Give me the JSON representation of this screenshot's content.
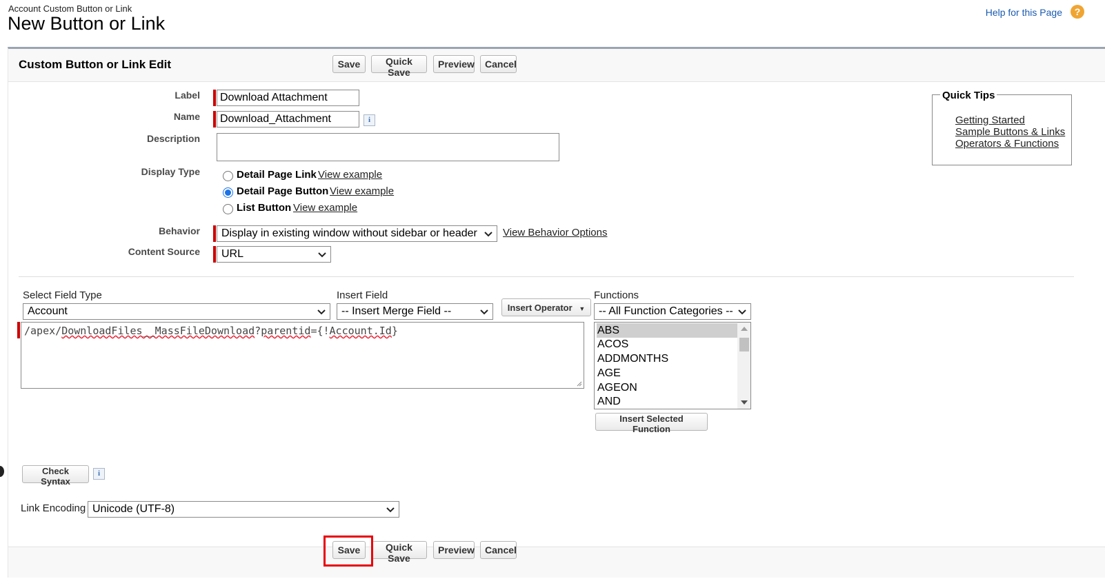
{
  "header": {
    "breadcrumb": "Account Custom Button or Link",
    "title": "New Button or Link",
    "help_link": "Help for this Page",
    "help_icon": "?"
  },
  "section_title": "Custom Button or Link Edit",
  "buttons": {
    "save": "Save",
    "quick_save": "Quick Save",
    "preview": "Preview",
    "cancel": "Cancel",
    "check_syntax": "Check Syntax",
    "insert_operator": "Insert Operator",
    "insert_selected_function": "Insert Selected Function"
  },
  "fields": {
    "label": {
      "label": "Label",
      "value": "Download Attachment"
    },
    "name": {
      "label": "Name",
      "value": "Download_Attachment"
    },
    "description": {
      "label": "Description",
      "value": ""
    },
    "display_type": {
      "label": "Display Type",
      "options": [
        {
          "label": "Detail Page Link",
          "link": "View example",
          "selected": false
        },
        {
          "label": "Detail Page Button",
          "link": "View example",
          "selected": true
        },
        {
          "label": "List Button",
          "link": "View example",
          "selected": false
        }
      ]
    },
    "behavior": {
      "label": "Behavior",
      "value": "Display in existing window without sidebar or header",
      "link": "View Behavior Options"
    },
    "content_source": {
      "label": "Content Source",
      "value": "URL"
    }
  },
  "quick_tips": {
    "title": "Quick Tips",
    "links": [
      "Getting Started",
      "Sample Buttons & Links",
      "Operators & Functions"
    ]
  },
  "formula_builder": {
    "select_field_type": {
      "label": "Select Field Type",
      "value": "Account"
    },
    "insert_field": {
      "label": "Insert Field",
      "value": "-- Insert Merge Field --"
    },
    "functions": {
      "label": "Functions",
      "category": "-- All Function Categories --",
      "items": [
        "ABS",
        "ACOS",
        "ADDMONTHS",
        "AGE",
        "AGEON",
        "AND"
      ],
      "selected": "ABS"
    },
    "formula_parts": [
      "/apex/",
      "DownloadFiles__MassFileDownload",
      "?",
      "parentid",
      "={!",
      "Account.Id",
      "}"
    ]
  },
  "link_encoding": {
    "label": "Link Encoding",
    "value": "Unicode (UTF-8)"
  },
  "colors": {
    "required": "#cc0000",
    "highlight": "#e8000b",
    "link": "#1a5bb0"
  }
}
